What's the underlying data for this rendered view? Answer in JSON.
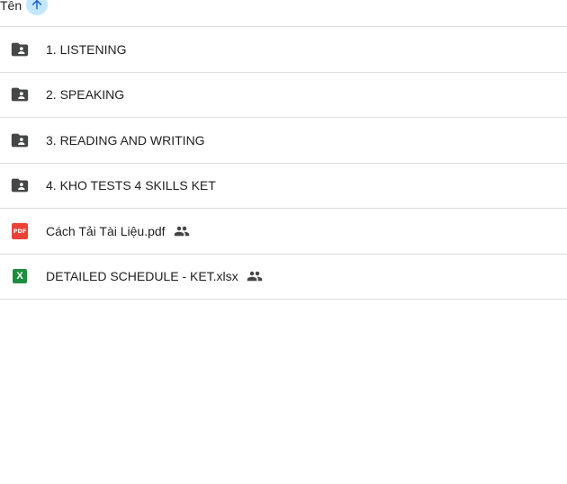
{
  "header": {
    "name_label": "Tên",
    "sort_icon": "arrow-upward-icon"
  },
  "rows": [
    {
      "label": "1. LISTENING",
      "icon": "shared-folder-icon"
    },
    {
      "label": "2. SPEAKING",
      "icon": "shared-folder-icon"
    },
    {
      "label": "3. READING AND WRITING",
      "icon": "shared-folder-icon"
    },
    {
      "label": "4. KHO TESTS 4 SKILLS KET",
      "icon": "shared-folder-icon"
    },
    {
      "label": "Cách Tải Tài Liệu.pdf",
      "icon": "pdf-icon",
      "badge": "PDF",
      "shared_icon": "people-icon"
    },
    {
      "label": "DETAILED SCHEDULE - KET.xlsx",
      "icon": "excel-icon",
      "badge": "X",
      "shared_icon": "people-icon"
    }
  ],
  "colors": {
    "folder": "#444746",
    "pdf": "#ea4335",
    "excel": "#1e8e3e",
    "sort_button_bg": "#c2e7ff",
    "divider": "#dadce0"
  }
}
